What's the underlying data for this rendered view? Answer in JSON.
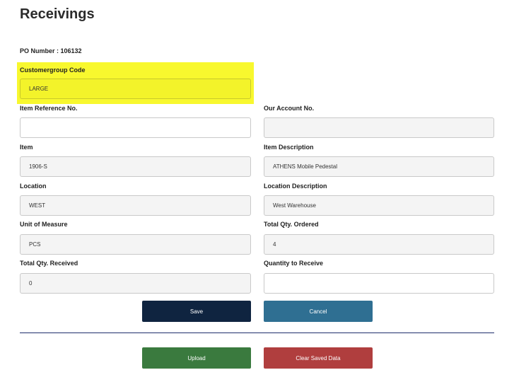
{
  "page": {
    "title": "Receivings",
    "po_label": "PO Number : ",
    "po_value": "106132"
  },
  "fields": {
    "customergroup_code": {
      "label": "Customergroup Code",
      "value": "LARGE",
      "placeholder": ""
    },
    "item_reference_no": {
      "label": "Item Reference No.",
      "value": "",
      "placeholder": ""
    },
    "our_account_no": {
      "label": "Our Account No.",
      "value": "",
      "placeholder": ""
    },
    "item": {
      "label": "Item",
      "value": "1906-S",
      "placeholder": ""
    },
    "item_description": {
      "label": "Item Description",
      "value": "ATHENS Mobile Pedestal",
      "placeholder": ""
    },
    "location": {
      "label": "Location",
      "value": "WEST",
      "placeholder": ""
    },
    "location_description": {
      "label": "Location Description",
      "value": "West Warehouse",
      "placeholder": ""
    },
    "unit_of_measure": {
      "label": "Unit of Measure",
      "value": "PCS",
      "placeholder": ""
    },
    "total_qty_ordered": {
      "label": "Total Qty. Ordered",
      "value": "4",
      "placeholder": ""
    },
    "total_qty_received": {
      "label": "Total Qty. Received",
      "value": "0",
      "placeholder": ""
    },
    "quantity_to_receive": {
      "label": "Quantity to Receive",
      "value": "",
      "placeholder": ""
    }
  },
  "buttons": {
    "save": {
      "label": "Save",
      "color": "#0f2440"
    },
    "cancel": {
      "label": "Cancel",
      "color": "#2f6f92"
    },
    "upload": {
      "label": "Upload",
      "color": "#3a7a3e"
    },
    "clear": {
      "label": "Clear Saved Data",
      "color": "#b03e3e"
    }
  },
  "colors": {
    "highlight": "#f8f82e",
    "divider": "#1f2d6b"
  }
}
